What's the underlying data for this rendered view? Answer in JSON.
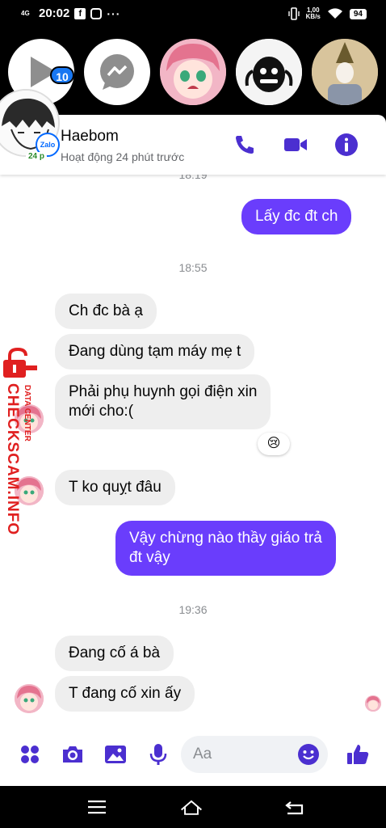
{
  "status_bar": {
    "network": "4G",
    "time": "20:02",
    "speed_value": "1,00",
    "speed_unit": "KB/s",
    "battery": "94"
  },
  "chat_heads": {
    "badge_count": "10",
    "items": [
      "play-icon",
      "messenger-icon",
      "anime-avatar",
      "mask-avatar",
      "person-avatar"
    ]
  },
  "header": {
    "name": "Haebom",
    "status": "Hoạt động 24 phút trước",
    "avatar_badge": "Zalo",
    "online_pill": "24 p"
  },
  "watermark": {
    "main": "CHECKSCAM.INFO",
    "sub": "DATA CENTER"
  },
  "messages": {
    "ts_partial": "18:19",
    "m1": "Lấy đc đt ch",
    "ts1": "18:55",
    "m2": "Ch đc bà ạ",
    "m3": "Đang dùng tạm máy mẹ t",
    "m4_line1": "Phải phụ huynh gọi điện xin",
    "m4_line2": "mới cho:(",
    "reaction": "😢",
    "m5": "T ko quỵt đâu",
    "m6_line1": "Vậy chừng nào thầy giáo trả",
    "m6_line2": "đt vậy",
    "ts2": "19:36",
    "m7": "Đang cố á bà",
    "m8": "T đang cố xin ấy"
  },
  "composer": {
    "placeholder": "Aa"
  },
  "colors": {
    "accent": "#6a3dfc",
    "icon_blue": "#4b2fd0",
    "incoming_bubble": "#eeeeee"
  }
}
